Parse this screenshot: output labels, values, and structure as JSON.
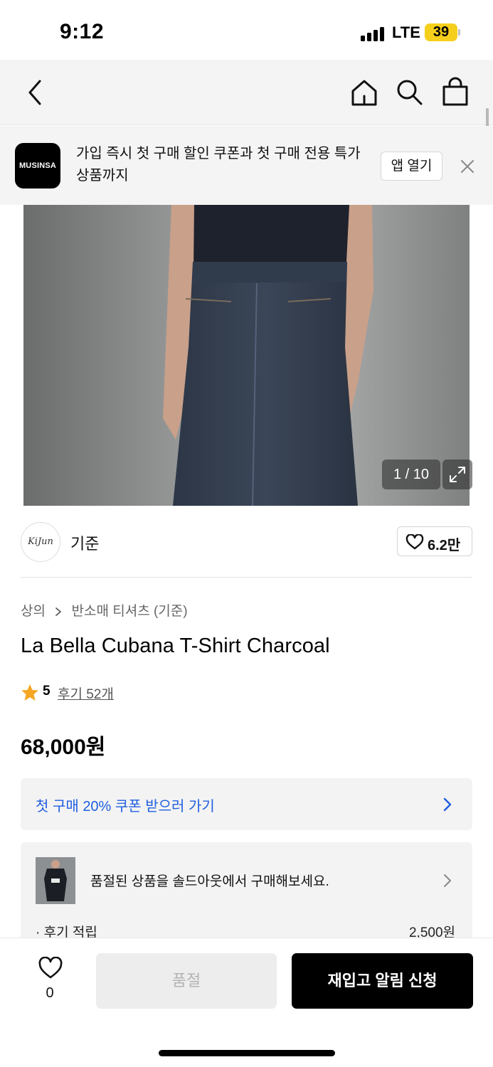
{
  "status_bar": {
    "time": "9:12",
    "network": "LTE",
    "battery": "39",
    "battery_color": "#f6cf1c"
  },
  "nav": {
    "back_icon": "chevron-left-icon",
    "home_icon": "home-icon",
    "search_icon": "search-icon",
    "cart_icon": "shopping-bag-icon"
  },
  "promo": {
    "logo_text": "MUSINSA",
    "message": "가입 즉시 첫 구매 할인 쿠폰과 첫 구매 전용 특가 상품까지",
    "open_app_label": "앱 열기",
    "close_icon": "close-icon"
  },
  "gallery": {
    "counter": "1 / 10",
    "expand_icon": "expand-icon"
  },
  "brand": {
    "logo_text": "KiJun",
    "name": "기준",
    "like_count": "6.2만"
  },
  "product": {
    "breadcrumb": [
      "상의",
      "반소매 티셔츠 (기준)"
    ],
    "title": "La Bella Cubana T-Shirt Charcoal",
    "rating_score": "5",
    "review_link": "후기 52개",
    "price": "68,000원",
    "star_color": "#f5a623"
  },
  "coupon": {
    "label": "첫 구매 20% 쿠폰 받으러 가기",
    "link_color": "#1f5fe0"
  },
  "soldout": {
    "message": "품절된 상품을 솔드아웃에서 구매해보세요.",
    "reward_label": "· 후기 적립",
    "reward_value": "2,500원"
  },
  "bottom_bar": {
    "wish_count": "0",
    "soldout_label": "품절",
    "restock_label": "재입고 알림 신청"
  }
}
